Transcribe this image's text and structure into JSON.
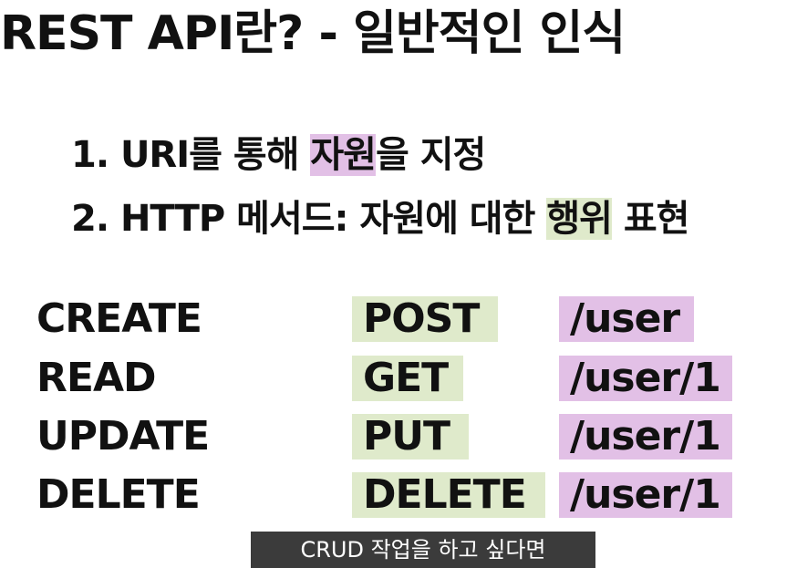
{
  "slide": {
    "title": "REST API란? - 일반적인 인식",
    "points": [
      {
        "pre": "1. URI를 통해 ",
        "highlight": "자원",
        "post": "을 지정"
      },
      {
        "pre": "2. HTTP 메서드: 자원에 대한 ",
        "highlight": "행위",
        "post": " 표현"
      }
    ],
    "table": [
      {
        "op": "CREATE",
        "method": "POST",
        "uri": "/user"
      },
      {
        "op": "READ",
        "method": "GET",
        "uri": "/user/1"
      },
      {
        "op": "UPDATE",
        "method": "PUT",
        "uri": "/user/1"
      },
      {
        "op": "DELETE",
        "method": "DELETE",
        "uri": "/user/1"
      }
    ],
    "colors": {
      "resource_highlight": "#e2c0e6",
      "action_highlight": "#dfeacb"
    }
  },
  "subtitle": "CRUD 작업을 하고 싶다면"
}
